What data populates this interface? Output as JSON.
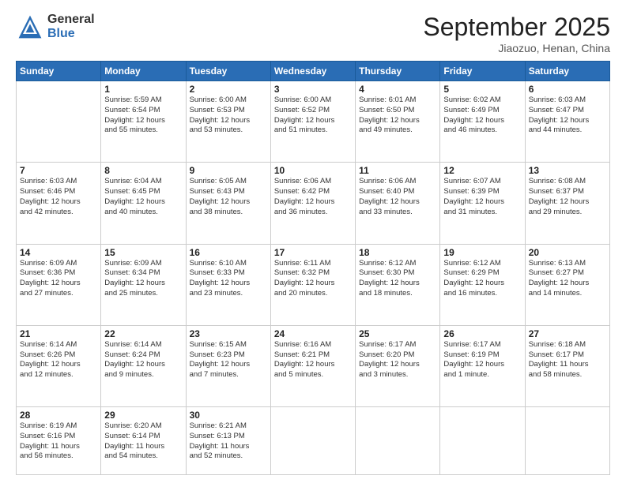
{
  "logo": {
    "general": "General",
    "blue": "Blue"
  },
  "header": {
    "month": "September 2025",
    "location": "Jiaozuo, Henan, China"
  },
  "weekdays": [
    "Sunday",
    "Monday",
    "Tuesday",
    "Wednesday",
    "Thursday",
    "Friday",
    "Saturday"
  ],
  "weeks": [
    [
      {
        "day": "",
        "info": ""
      },
      {
        "day": "1",
        "info": "Sunrise: 5:59 AM\nSunset: 6:54 PM\nDaylight: 12 hours\nand 55 minutes."
      },
      {
        "day": "2",
        "info": "Sunrise: 6:00 AM\nSunset: 6:53 PM\nDaylight: 12 hours\nand 53 minutes."
      },
      {
        "day": "3",
        "info": "Sunrise: 6:00 AM\nSunset: 6:52 PM\nDaylight: 12 hours\nand 51 minutes."
      },
      {
        "day": "4",
        "info": "Sunrise: 6:01 AM\nSunset: 6:50 PM\nDaylight: 12 hours\nand 49 minutes."
      },
      {
        "day": "5",
        "info": "Sunrise: 6:02 AM\nSunset: 6:49 PM\nDaylight: 12 hours\nand 46 minutes."
      },
      {
        "day": "6",
        "info": "Sunrise: 6:03 AM\nSunset: 6:47 PM\nDaylight: 12 hours\nand 44 minutes."
      }
    ],
    [
      {
        "day": "7",
        "info": "Sunrise: 6:03 AM\nSunset: 6:46 PM\nDaylight: 12 hours\nand 42 minutes."
      },
      {
        "day": "8",
        "info": "Sunrise: 6:04 AM\nSunset: 6:45 PM\nDaylight: 12 hours\nand 40 minutes."
      },
      {
        "day": "9",
        "info": "Sunrise: 6:05 AM\nSunset: 6:43 PM\nDaylight: 12 hours\nand 38 minutes."
      },
      {
        "day": "10",
        "info": "Sunrise: 6:06 AM\nSunset: 6:42 PM\nDaylight: 12 hours\nand 36 minutes."
      },
      {
        "day": "11",
        "info": "Sunrise: 6:06 AM\nSunset: 6:40 PM\nDaylight: 12 hours\nand 33 minutes."
      },
      {
        "day": "12",
        "info": "Sunrise: 6:07 AM\nSunset: 6:39 PM\nDaylight: 12 hours\nand 31 minutes."
      },
      {
        "day": "13",
        "info": "Sunrise: 6:08 AM\nSunset: 6:37 PM\nDaylight: 12 hours\nand 29 minutes."
      }
    ],
    [
      {
        "day": "14",
        "info": "Sunrise: 6:09 AM\nSunset: 6:36 PM\nDaylight: 12 hours\nand 27 minutes."
      },
      {
        "day": "15",
        "info": "Sunrise: 6:09 AM\nSunset: 6:34 PM\nDaylight: 12 hours\nand 25 minutes."
      },
      {
        "day": "16",
        "info": "Sunrise: 6:10 AM\nSunset: 6:33 PM\nDaylight: 12 hours\nand 23 minutes."
      },
      {
        "day": "17",
        "info": "Sunrise: 6:11 AM\nSunset: 6:32 PM\nDaylight: 12 hours\nand 20 minutes."
      },
      {
        "day": "18",
        "info": "Sunrise: 6:12 AM\nSunset: 6:30 PM\nDaylight: 12 hours\nand 18 minutes."
      },
      {
        "day": "19",
        "info": "Sunrise: 6:12 AM\nSunset: 6:29 PM\nDaylight: 12 hours\nand 16 minutes."
      },
      {
        "day": "20",
        "info": "Sunrise: 6:13 AM\nSunset: 6:27 PM\nDaylight: 12 hours\nand 14 minutes."
      }
    ],
    [
      {
        "day": "21",
        "info": "Sunrise: 6:14 AM\nSunset: 6:26 PM\nDaylight: 12 hours\nand 12 minutes."
      },
      {
        "day": "22",
        "info": "Sunrise: 6:14 AM\nSunset: 6:24 PM\nDaylight: 12 hours\nand 9 minutes."
      },
      {
        "day": "23",
        "info": "Sunrise: 6:15 AM\nSunset: 6:23 PM\nDaylight: 12 hours\nand 7 minutes."
      },
      {
        "day": "24",
        "info": "Sunrise: 6:16 AM\nSunset: 6:21 PM\nDaylight: 12 hours\nand 5 minutes."
      },
      {
        "day": "25",
        "info": "Sunrise: 6:17 AM\nSunset: 6:20 PM\nDaylight: 12 hours\nand 3 minutes."
      },
      {
        "day": "26",
        "info": "Sunrise: 6:17 AM\nSunset: 6:19 PM\nDaylight: 12 hours\nand 1 minute."
      },
      {
        "day": "27",
        "info": "Sunrise: 6:18 AM\nSunset: 6:17 PM\nDaylight: 11 hours\nand 58 minutes."
      }
    ],
    [
      {
        "day": "28",
        "info": "Sunrise: 6:19 AM\nSunset: 6:16 PM\nDaylight: 11 hours\nand 56 minutes."
      },
      {
        "day": "29",
        "info": "Sunrise: 6:20 AM\nSunset: 6:14 PM\nDaylight: 11 hours\nand 54 minutes."
      },
      {
        "day": "30",
        "info": "Sunrise: 6:21 AM\nSunset: 6:13 PM\nDaylight: 11 hours\nand 52 minutes."
      },
      {
        "day": "",
        "info": ""
      },
      {
        "day": "",
        "info": ""
      },
      {
        "day": "",
        "info": ""
      },
      {
        "day": "",
        "info": ""
      }
    ]
  ]
}
